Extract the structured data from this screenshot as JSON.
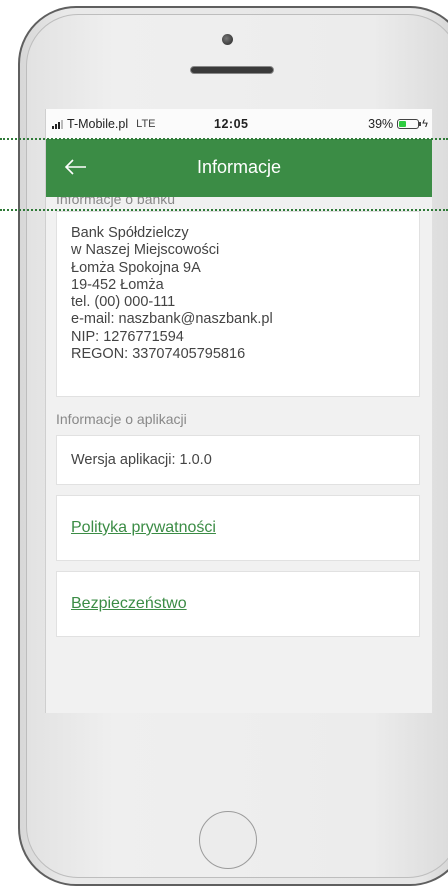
{
  "status_bar": {
    "carrier": "T-Mobile.pl",
    "network": "LTE",
    "time": "12:05",
    "battery": "39%",
    "battery_level": 0.39
  },
  "app_bar": {
    "title": "Informacje"
  },
  "bank_section": {
    "label": "Informacje o banku",
    "lines": [
      "Bank Spółdzielczy",
      "w Naszej Miejscowości",
      "Łomża Spokojna 9A",
      "19-452 Łomża",
      "tel. (00) 000-111",
      "e-mail: naszbank@naszbank.pl",
      "NIP: 1276771594",
      "REGON: 33707405795816"
    ]
  },
  "app_section": {
    "label": "Informacje o aplikacji",
    "version": "Wersja aplikacji: 1.0.0"
  },
  "links": {
    "privacy": "Polityka prywatności",
    "security": "Bezpieczeństwo"
  },
  "colors": {
    "accent": "#3b8c45",
    "battery_fill": "#2ecc40"
  },
  "icons": {
    "back": "arrow-left-icon",
    "signal": "signal-icon",
    "battery": "battery-icon",
    "charging": "lightning-icon"
  }
}
